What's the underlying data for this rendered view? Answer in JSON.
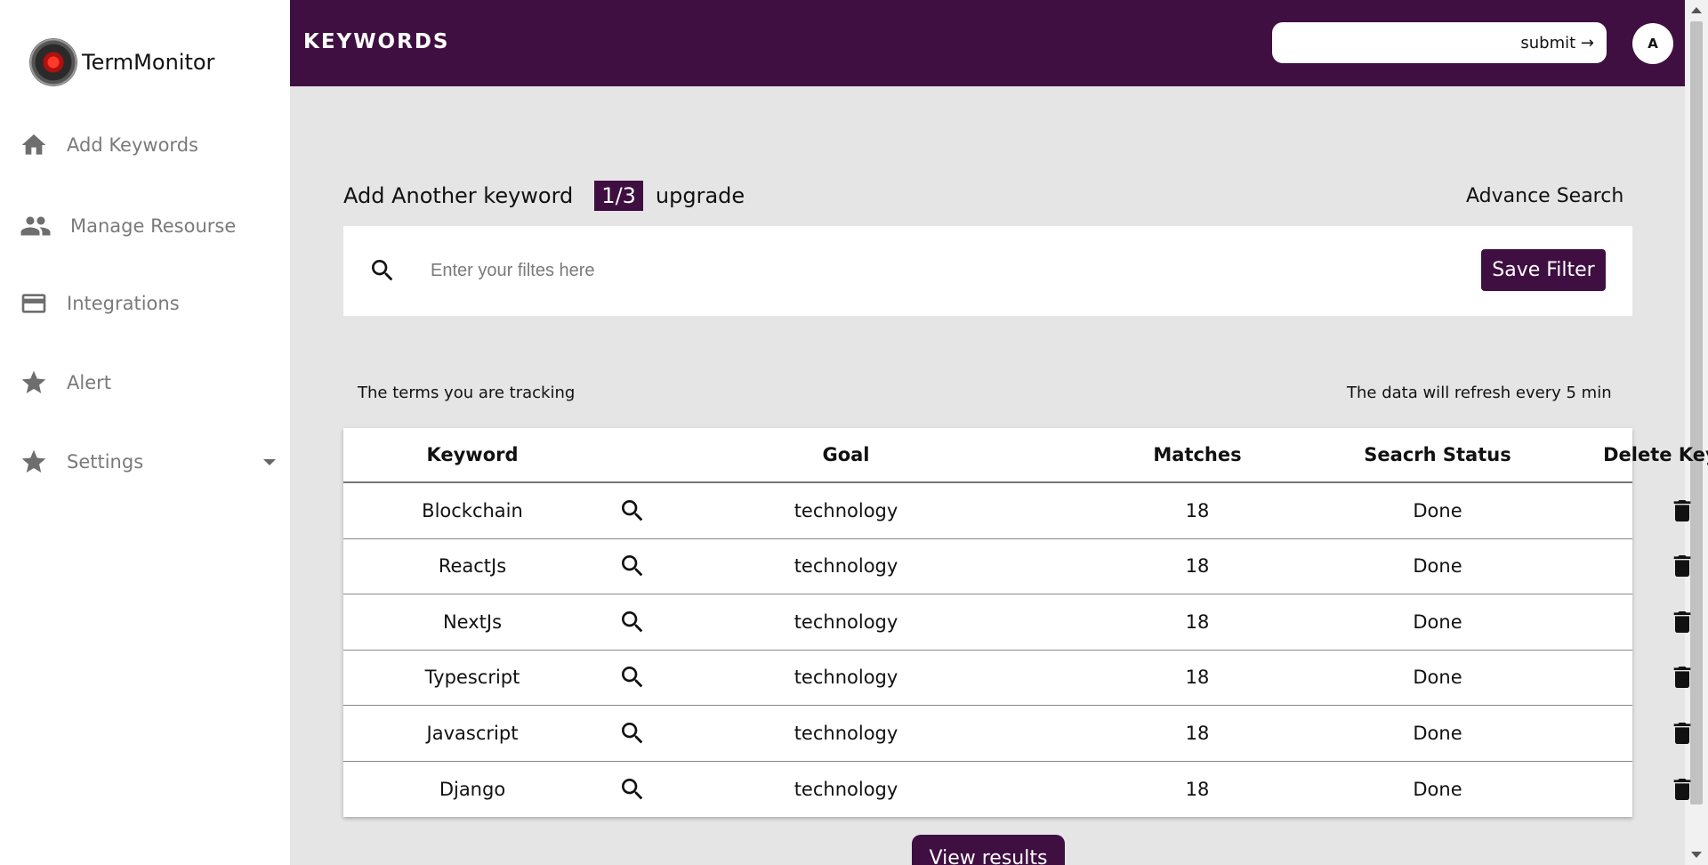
{
  "brand": {
    "name": "TermMonitor",
    "logo_icon": "eye-logo-icon"
  },
  "sidebar": {
    "items": [
      {
        "label": "Add Keywords",
        "icon": "home-icon"
      },
      {
        "label": "Manage Resourse",
        "icon": "people-icon"
      },
      {
        "label": "Integrations",
        "icon": "credit-card-icon"
      },
      {
        "label": "Alert",
        "icon": "star-icon"
      },
      {
        "label": "Settings",
        "icon": "star-icon"
      }
    ]
  },
  "header": {
    "title": "KEYWORDS",
    "submit_label": "submit →",
    "avatar_initial": "A"
  },
  "keywords": {
    "add_label": "Add Another keyword",
    "quota": "1/3",
    "upgrade_label": "upgrade",
    "advance_search_label": "Advance Search"
  },
  "filter": {
    "placeholder": "Enter your filtes here",
    "save_label": "Save Filter"
  },
  "tracking_note": "The terms you are tracking",
  "refresh_note": "The data will refresh every 5 min",
  "table": {
    "headers": {
      "keyword": "Keyword",
      "goal": "Goal",
      "matches": "Matches",
      "status": "Seacrh Status",
      "delete": "Delete Keyword"
    },
    "rows": [
      {
        "keyword": "Blockchain",
        "goal": "technology",
        "matches": "18",
        "status": "Done"
      },
      {
        "keyword": "ReactJs",
        "goal": "technology",
        "matches": "18",
        "status": "Done"
      },
      {
        "keyword": "NextJs",
        "goal": "technology",
        "matches": "18",
        "status": "Done"
      },
      {
        "keyword": "Typescript",
        "goal": "technology",
        "matches": "18",
        "status": "Done"
      },
      {
        "keyword": "Javascript",
        "goal": "technology",
        "matches": "18",
        "status": "Done"
      },
      {
        "keyword": "Django",
        "goal": "technology",
        "matches": "18",
        "status": "Done"
      }
    ]
  },
  "view_results_label": "View results",
  "colors": {
    "accent": "#3f0f41",
    "background": "#e5e5e5"
  }
}
